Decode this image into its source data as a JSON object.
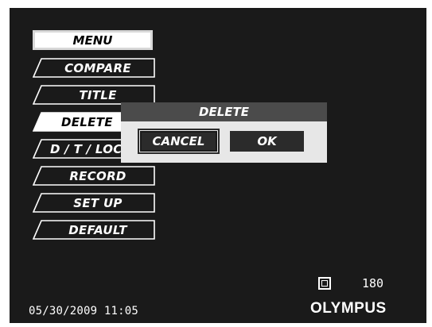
{
  "menu": {
    "header_label": "MENU",
    "items": [
      {
        "label": "COMPARE",
        "selected": false
      },
      {
        "label": "TITLE",
        "selected": false
      },
      {
        "label": "DELETE",
        "selected": true
      },
      {
        "label": "D / T / LOCK",
        "selected": false
      },
      {
        "label": "RECORD",
        "selected": false
      },
      {
        "label": "SET UP",
        "selected": false
      },
      {
        "label": "DEFAULT",
        "selected": false
      }
    ]
  },
  "dialog": {
    "title": "DELETE",
    "cancel_label": "CANCEL",
    "ok_label": "OK",
    "focused": "CANCEL"
  },
  "status": {
    "frame_icon": "single-frame-icon",
    "remaining_shots": "180",
    "datetime": "05/30/2009 11:05",
    "brand_logo": "OLYMPUS"
  },
  "colors": {
    "screen_background": "#1a1a1a",
    "dialog_background": "#e7e7e7",
    "dialog_title_bar": "#4b4b4b",
    "button_background": "#2b2b2b",
    "selected_item": "#ffffff"
  }
}
